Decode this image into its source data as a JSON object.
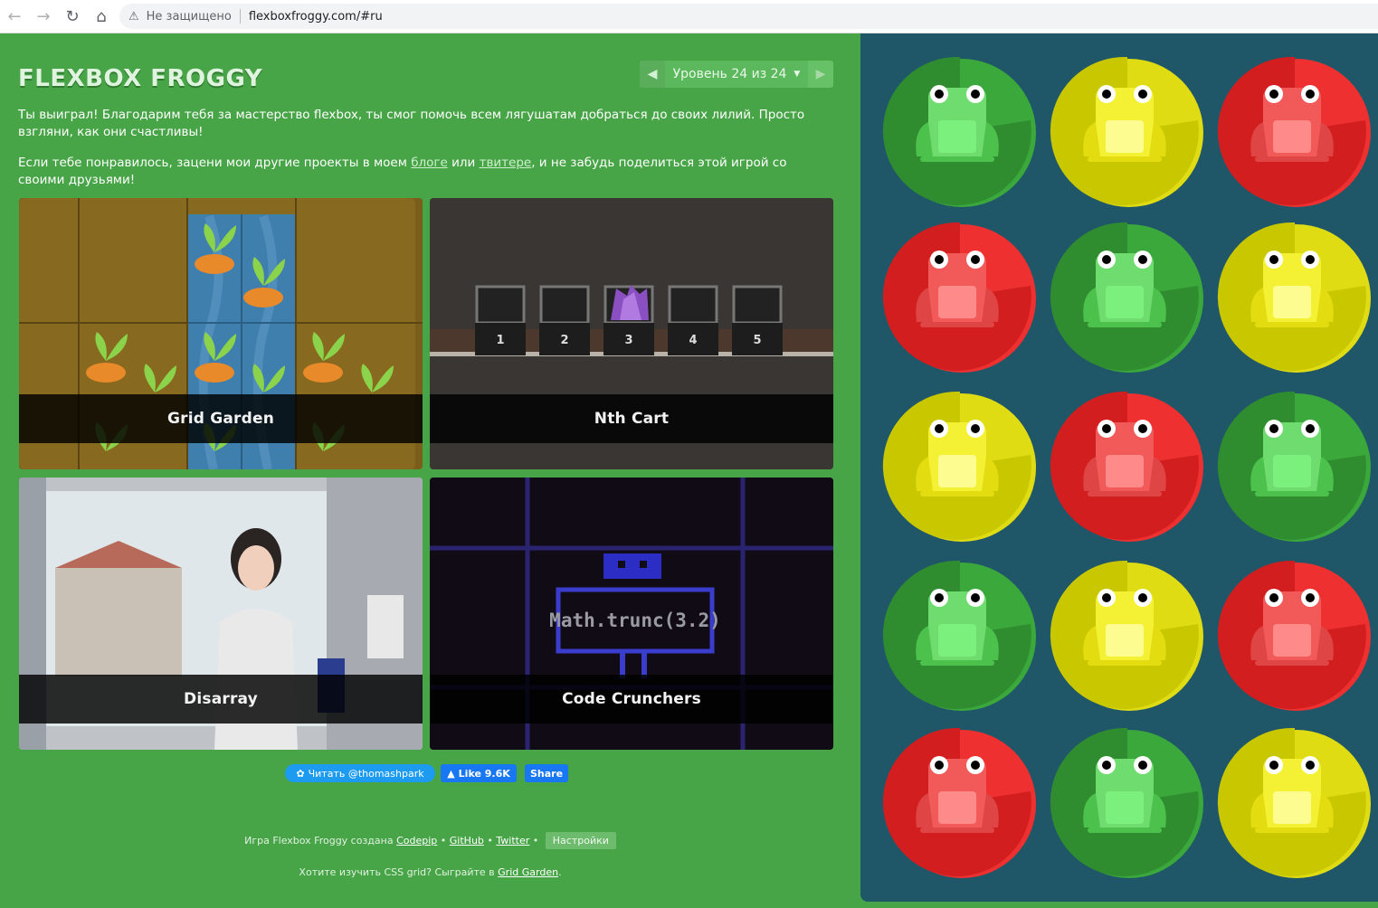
{
  "browser": {
    "security_label": "Не защищено",
    "url": "flexboxfroggy.com/#ru"
  },
  "header": {
    "logo": "FLEXBOX FROGGY",
    "level_label": "Уровень 24 из 24"
  },
  "message": {
    "win_text": "Ты выиграл! Благодарим тебя за мастерство flexbox, ты смог помочь всем лягушатам добраться до своих лилий. Просто взгляни, как они счастливы!",
    "promo_before": "Если тебе понравилось, зацени мои другие проекты в моем ",
    "blog_link": "блоге",
    "promo_or": " или ",
    "twitter_link": "твитере",
    "promo_after": ", и не забудь поделиться этой игрой со своими друзьями!"
  },
  "projects": [
    {
      "title": "Grid Garden"
    },
    {
      "title": "Nth Cart"
    },
    {
      "title": "Disarray"
    },
    {
      "title": "Code Crunchers"
    }
  ],
  "nth_cart_numbers": [
    "1",
    "2",
    "3",
    "4",
    "5"
  ],
  "code_crunchers_text": "Math.trunc(3.2)",
  "social": {
    "twitter_follow": "Читать @thomashpark",
    "fb_like": "Like 9.6K",
    "fb_share": "Share"
  },
  "footer": {
    "credit_prefix": "Игра Flexbox Froggy создана ",
    "codepip": "Codepip",
    "github": "GitHub",
    "twitter": "Twitter",
    "settings": "Настройки",
    "grid_prefix": "Хотите изучить CSS grid? Сыграйте в ",
    "grid_link": "Grid Garden",
    "grid_suffix": "."
  },
  "colors": {
    "green_bg": "#47a447",
    "board_bg": "#1f5768",
    "frog_green": "#6fdc6f",
    "frog_yellow": "#f4f033",
    "frog_red": "#f25a5a",
    "pad_green": "#2f8d2f",
    "pad_yellow": "#c9c700",
    "pad_red": "#d21e1e"
  },
  "board": [
    [
      "green",
      "yellow",
      "red"
    ],
    [
      "red",
      "green",
      "yellow"
    ],
    [
      "yellow",
      "red",
      "green"
    ],
    [
      "green",
      "yellow",
      "red"
    ],
    [
      "red",
      "green",
      "yellow"
    ]
  ]
}
